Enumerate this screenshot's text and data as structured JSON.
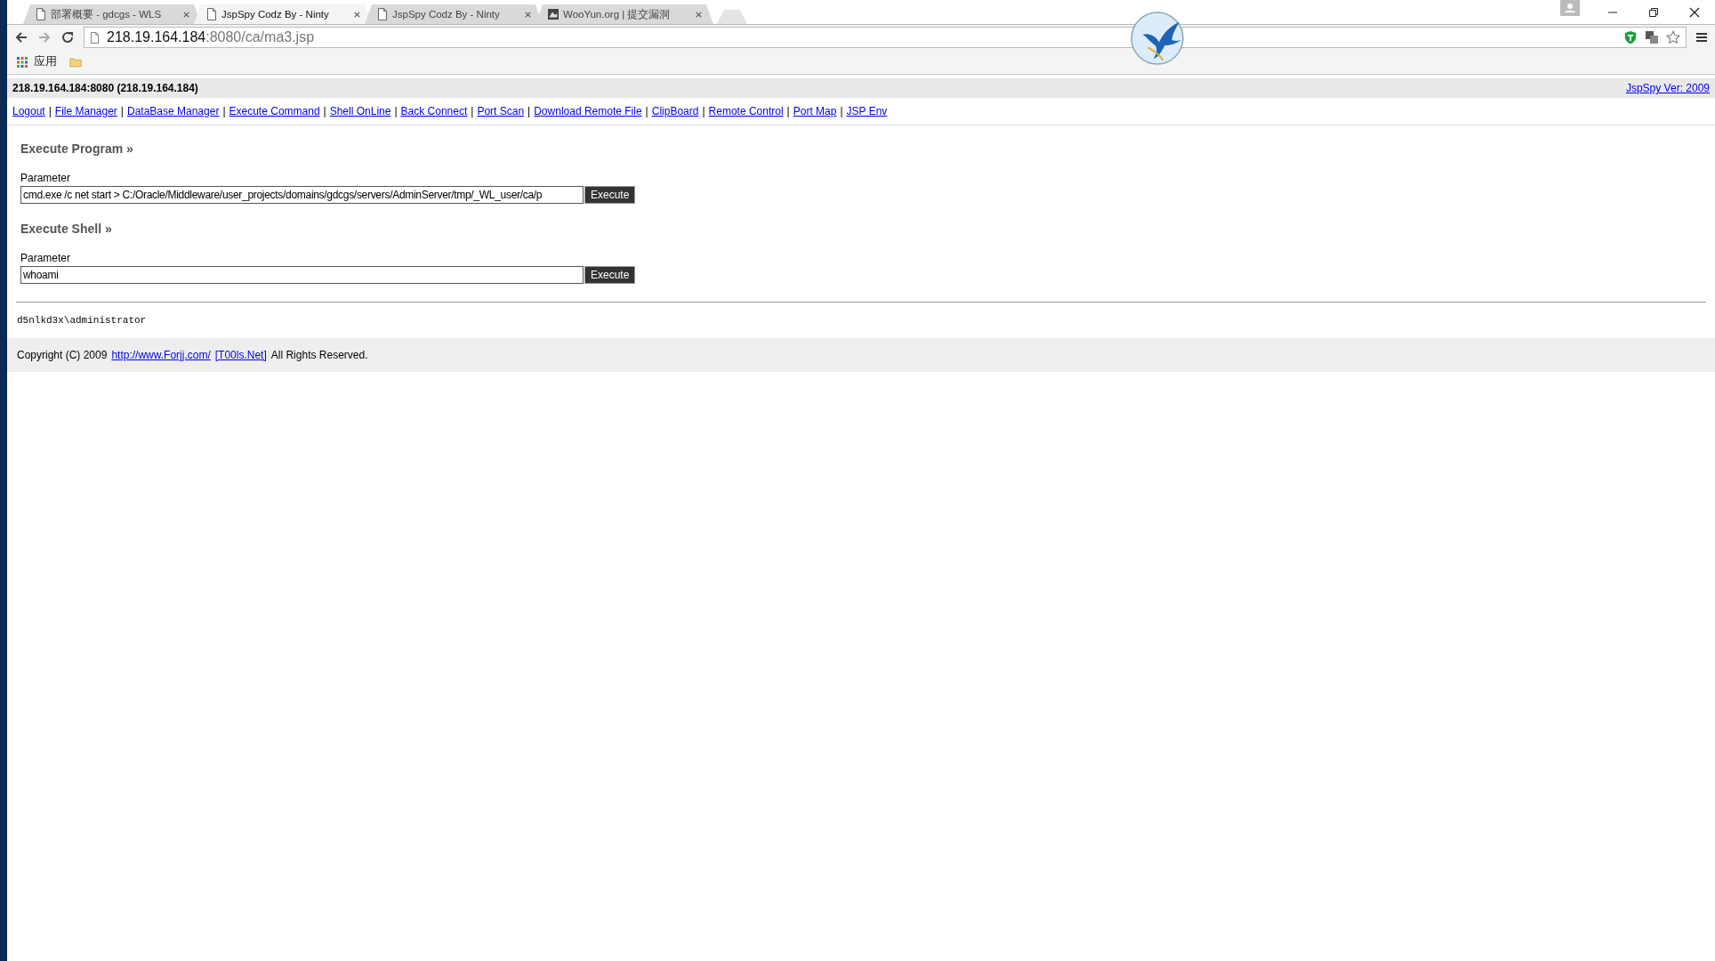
{
  "browser": {
    "tabs": [
      {
        "title": "部署概要 - gdcgs - WLS",
        "kind": "page",
        "selected": false
      },
      {
        "title": "JspSpy Codz By - Ninty",
        "kind": "page",
        "selected": true
      },
      {
        "title": "JspSpy Codz By - Ninty",
        "kind": "page",
        "selected": false
      },
      {
        "title": "WooYun.org | 提交漏洞",
        "kind": "site",
        "selected": false
      }
    ],
    "address": {
      "host": "218.19.164.184",
      "path": ":8080/ca/ma3.jsp"
    },
    "bookmarks": [
      {
        "label": "应用",
        "kind": "apps"
      },
      {
        "kind": "folder"
      }
    ]
  },
  "page": {
    "header": "218.19.164.184:8080 (218.19.164.184)",
    "version_link": "JspSpy Ver: 2009",
    "nav_items": [
      {
        "kind": "link",
        "text": "Logout"
      },
      {
        "kind": "separator",
        "text": "|"
      },
      {
        "kind": "link",
        "text": "File Manager"
      },
      {
        "kind": "separator",
        "text": "|"
      },
      {
        "kind": "link",
        "text": "DataBase Manager"
      },
      {
        "kind": "separator",
        "text": "|"
      },
      {
        "kind": "link",
        "text": "Execute Command"
      },
      {
        "kind": "separator",
        "text": "|"
      },
      {
        "kind": "link",
        "text": "Shell OnLine"
      },
      {
        "kind": "separator",
        "text": "|"
      },
      {
        "kind": "link",
        "text": "Back Connect"
      },
      {
        "kind": "separator",
        "text": "|"
      },
      {
        "kind": "link",
        "text": "Port Scan"
      },
      {
        "kind": "separator",
        "text": "|"
      },
      {
        "kind": "link",
        "text": "Download Remote File"
      },
      {
        "kind": "separator",
        "text": "|"
      },
      {
        "kind": "link",
        "text": "ClipBoard"
      },
      {
        "kind": "separator",
        "text": "|"
      },
      {
        "kind": "link",
        "text": "Remote Control"
      },
      {
        "kind": "separator",
        "text": "|"
      },
      {
        "kind": "link",
        "text": "Port Map"
      },
      {
        "kind": "separator",
        "text": "|"
      },
      {
        "kind": "link",
        "text": "JSP Env"
      }
    ],
    "sections": [
      {
        "title": "Execute Program »",
        "label": "Parameter",
        "value": "cmd.exe /c net start > C:/Oracle/Middleware/user_projects/domains/gdcgs/servers/AdminServer/tmp/_WL_user/ca/p",
        "button": "Execute"
      },
      {
        "title": "Execute Shell »",
        "label": "Parameter",
        "value": "whoami",
        "button": "Execute"
      }
    ],
    "output": "d5nlkd3x\\administrator",
    "footer": {
      "text": "Copyright (C) 2009",
      "links": [
        "http://www.Forjj.com/",
        "[T00ls.Net]"
      ],
      "end": "All Rights Reserved."
    }
  }
}
